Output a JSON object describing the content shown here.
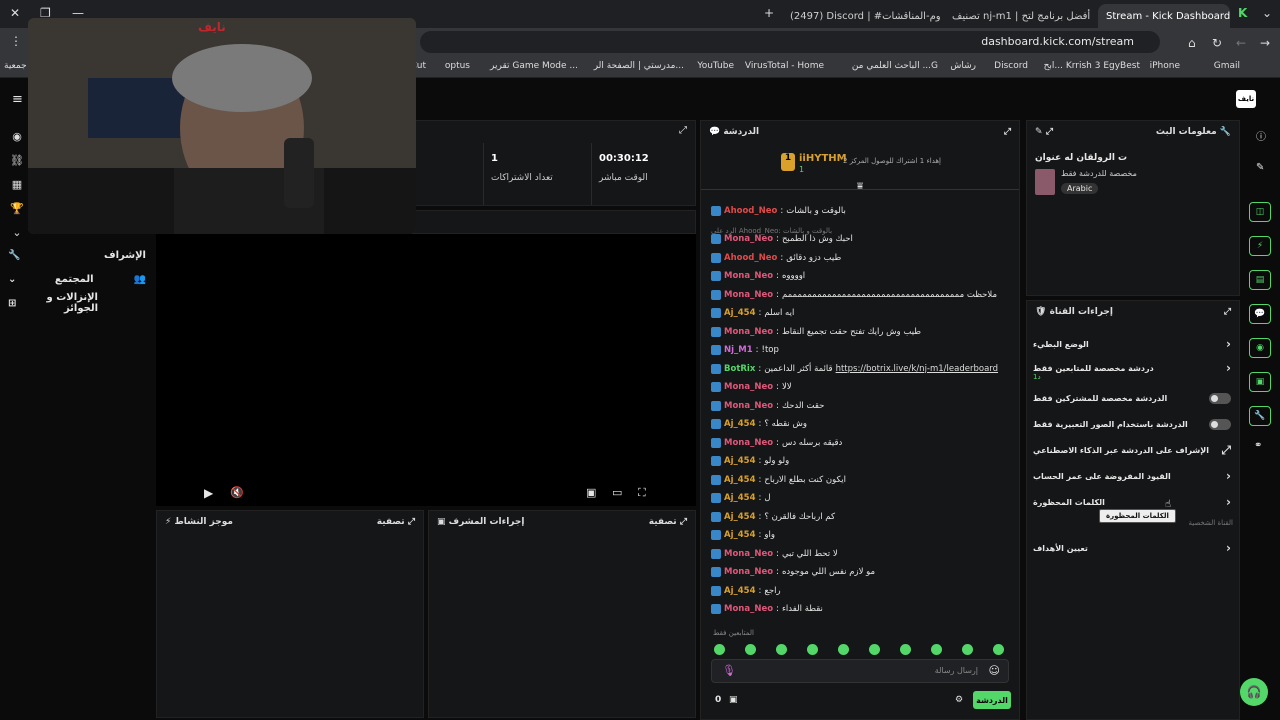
{
  "browser": {
    "tabs": [
      {
        "title": "Stream - Kick Dashboard",
        "active": true
      },
      {
        "title": "تصنيف nj-m1 | أفضل برنامج لتح",
        "active": false
      },
      {
        "title": "(2497) Discord | #روم-المناقشات",
        "active": false
      }
    ],
    "url": "dashboard.kick.com/stream",
    "bookmarks": [
      "Gmail",
      "iPhone",
      "ابح... Krrish 3 EgyBest",
      "Discord",
      "رشاش",
      "الباحث العلمي من ...G",
      "VirusTotal - Home",
      "YouTube",
      "مدرستي | الصفحة الر...",
      "تقرير Game Mode ...",
      "optus",
      "Cut",
      "جمعية"
    ]
  },
  "colors": {
    "accent": "#53d769",
    "mona": "#e0577a",
    "aj": "#d9a12b",
    "ahood": "#e04a4a",
    "nj": "#d06ad9",
    "botrix": "#53d769"
  },
  "left_nav": {
    "items": [
      "الإشراف",
      "المجتمع",
      "الإنزالات و الجوائز"
    ]
  },
  "stats_panel": {
    "uptime_value": "00:30:12",
    "uptime_label": "الوقت مباشر",
    "subs_value": "1",
    "subs_label": "تعداد الاشتراكات"
  },
  "activity_panel": {
    "title": "موجز النشاط",
    "filter": "تصفية"
  },
  "mod_panel": {
    "title": "إجراءات المشرف",
    "filter": "تصفية"
  },
  "chat": {
    "title": "الدردشة",
    "top_user": "iiHYTHM",
    "top_count": "1",
    "top_desc": "إهداء 1 اشتراك للوصول المركز 2",
    "reply_context": "الرد على Ahood_Neo: بالوقت و بالشات",
    "messages": [
      {
        "user": "Ahood_Neo",
        "text": "بالوقت و بالشات",
        "color": "ahood"
      },
      {
        "user": "Mona_Neo",
        "text": "احبك وش ذا الطمبح",
        "color": "mona"
      },
      {
        "user": "Ahood_Neo",
        "text": "طيب دزو دقائق",
        "color": "ahood"
      },
      {
        "user": "Mona_Neo",
        "text": "اووووه",
        "color": "mona"
      },
      {
        "user": "Mona_Neo",
        "text": "ملاحظت ممممممممممممممممممممممممممممممممممممم",
        "color": "mona"
      },
      {
        "user": "Aj_454",
        "text": "ايه اسلم",
        "color": "aj"
      },
      {
        "user": "Mona_Neo",
        "text": "طيب وش رايك تفتح حقت تجميع النقاط",
        "color": "mona"
      },
      {
        "user": "Nj_M1",
        "text": "!top",
        "color": "nj"
      },
      {
        "user": "BotRix",
        "text": "قائمة أكثر الداعمين",
        "link": "https://botrix.live/k/nj-m1/leaderboard",
        "color": "botrix"
      },
      {
        "user": "Mona_Neo",
        "text": "لالا",
        "color": "mona"
      },
      {
        "user": "Mona_Neo",
        "text": "حقت الدحك",
        "color": "mona"
      },
      {
        "user": "Aj_454",
        "text": "وش نقطه ؟",
        "color": "aj"
      },
      {
        "user": "Mona_Neo",
        "text": "دقيقه برسله دس",
        "color": "mona"
      },
      {
        "user": "Aj_454",
        "text": "ولو ولو",
        "color": "aj"
      },
      {
        "user": "Aj_454",
        "text": "ايكون كنت بطلع الارباح",
        "color": "aj"
      },
      {
        "user": "Aj_454",
        "text": "ل",
        "color": "aj"
      },
      {
        "user": "Aj_454",
        "text": "كم ارباحك فالقرن ؟",
        "color": "aj"
      },
      {
        "user": "Aj_454",
        "text": "واو",
        "color": "aj"
      },
      {
        "user": "Mona_Neo",
        "text": "لا تحط اللي تبي",
        "color": "mona"
      },
      {
        "user": "Mona_Neo",
        "text": "مو لازم نفس اللي موجوده",
        "color": "mona"
      },
      {
        "user": "Aj_454",
        "text": "راجع",
        "color": "aj"
      },
      {
        "user": "Mona_Neo",
        "text": "نقطة الفداء",
        "color": "mona"
      }
    ],
    "emote_tab": "المتابعين فقط",
    "input_placeholder": "إرسال رسالة",
    "send_label": "الدردشة",
    "viewer_count": "0"
  },
  "stream_info": {
    "title": "معلومات البث",
    "stream_title": "ت الرولقان له عنوان",
    "category": "مخصصة للدردشة فقط",
    "language": "Arabic"
  },
  "channel_actions": {
    "title": "إجراءات القناة",
    "rows": [
      {
        "label": "الوضع البطيء",
        "type": "chevron"
      },
      {
        "label": "دردشة مخصصة للمتابعين فقط",
        "sub": "1د",
        "type": "chevron"
      },
      {
        "label": "الدردشة مخصصة للمشتركين فقط",
        "type": "toggle"
      },
      {
        "label": "الدردشة باستخدام الصور التعبيرية فقط",
        "type": "toggle"
      },
      {
        "label": "الإشراف على الدردشة عبر الذكاء الاصطناعي",
        "type": "link"
      },
      {
        "label": "القيود المفروضة على عمر الحساب",
        "type": "chevron"
      },
      {
        "label": "الكلمات المحظورة",
        "type": "chevron"
      },
      {
        "label": "تعيين الأهداف",
        "type": "chevron"
      }
    ],
    "tooltip": "الكلمات المحظورة",
    "tooltip_sub": "القناة الشخصية"
  },
  "profile_badge": "نايف",
  "webcam_caption": "نايف"
}
